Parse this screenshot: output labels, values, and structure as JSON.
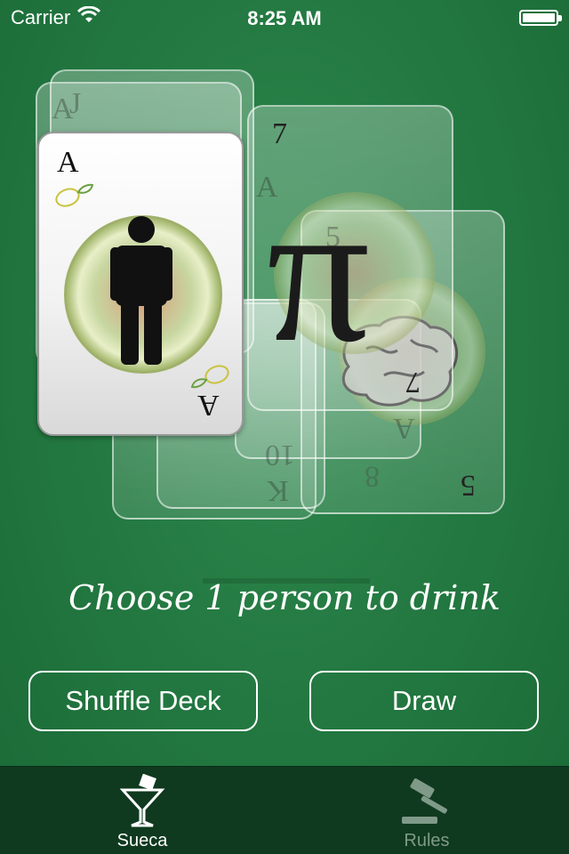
{
  "status_bar": {
    "carrier": "Carrier",
    "time": "8:25 AM",
    "wifi_icon": "wifi-icon",
    "battery_icon": "battery-icon"
  },
  "cards": {
    "back_ranks": [
      "A",
      "J"
    ],
    "main_card": {
      "rank": "A",
      "icon": "person-icon"
    },
    "right_top_card": {
      "rank": "7",
      "icon": "pi-icon",
      "symbol": "π"
    },
    "ghost_ranks": [
      "A",
      "5",
      "10",
      "K",
      "8",
      "A",
      "5",
      "7"
    ],
    "brain_card_icon": "brain-icon"
  },
  "prompt": "Choose 1 person to drink",
  "buttons": {
    "shuffle": "Shuffle Deck",
    "draw": "Draw"
  },
  "tab_bar": {
    "tabs": [
      {
        "label": "Sueca",
        "icon": "cocktail-glass-icon",
        "active": true
      },
      {
        "label": "Rules",
        "icon": "gavel-icon",
        "active": false
      }
    ]
  },
  "colors": {
    "felt": "#247a42",
    "tabbar": "#0f3a1f",
    "active_tab": "#ffffff",
    "inactive_tab": "#7f9a88"
  }
}
